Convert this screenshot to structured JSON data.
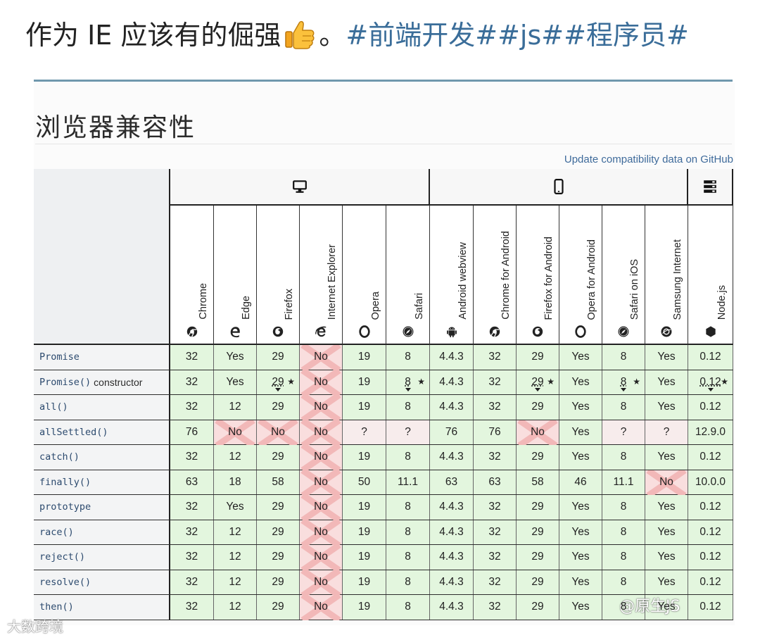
{
  "post": {
    "text": "作为 IE 应该有的倔强",
    "emoji": "thumbs-up-emoji",
    "punct": "。",
    "tags": "#前端开发##js##程序员#"
  },
  "section_title": "浏览器兼容性",
  "github_link": "Update compatibility data on GitHub",
  "groups": [
    {
      "name": "desktop",
      "icon": "desktop-icon"
    },
    {
      "name": "mobile",
      "icon": "mobile-icon"
    },
    {
      "name": "server",
      "icon": "server-icon"
    }
  ],
  "browsers": [
    {
      "name": "Chrome",
      "icon": "chrome-icon"
    },
    {
      "name": "Edge",
      "icon": "edge-icon"
    },
    {
      "name": "Firefox",
      "icon": "firefox-icon"
    },
    {
      "name": "Internet Explorer",
      "icon": "ie-icon"
    },
    {
      "name": "Opera",
      "icon": "opera-icon"
    },
    {
      "name": "Safari",
      "icon": "safari-icon"
    },
    {
      "name": "Android webview",
      "icon": "android-icon"
    },
    {
      "name": "Chrome for Android",
      "icon": "chrome-icon"
    },
    {
      "name": "Firefox for Android",
      "icon": "firefox-icon"
    },
    {
      "name": "Opera for Android",
      "icon": "opera-icon"
    },
    {
      "name": "Safari on iOS",
      "icon": "safari-icon"
    },
    {
      "name": "Samsung Internet",
      "icon": "samsung-icon"
    },
    {
      "name": "Node.js",
      "icon": "nodejs-icon"
    }
  ],
  "rows": [
    {
      "code": "Promise",
      "plain": "",
      "cells": [
        {
          "v": "32",
          "s": "yes"
        },
        {
          "v": "Yes",
          "s": "yes"
        },
        {
          "v": "29",
          "s": "yes"
        },
        {
          "v": "No",
          "s": "no"
        },
        {
          "v": "19",
          "s": "yes"
        },
        {
          "v": "8",
          "s": "yes"
        },
        {
          "v": "4.4.3",
          "s": "yes"
        },
        {
          "v": "32",
          "s": "yes"
        },
        {
          "v": "29",
          "s": "yes"
        },
        {
          "v": "Yes",
          "s": "yes"
        },
        {
          "v": "8",
          "s": "yes"
        },
        {
          "v": "Yes",
          "s": "yes"
        },
        {
          "v": "0.12",
          "s": "yes"
        }
      ]
    },
    {
      "code": "Promise()",
      "plain": "constructor",
      "cells": [
        {
          "v": "32",
          "s": "yes"
        },
        {
          "v": "Yes",
          "s": "yes"
        },
        {
          "v": "29",
          "s": "yes",
          "f": true
        },
        {
          "v": "No",
          "s": "no"
        },
        {
          "v": "19",
          "s": "yes"
        },
        {
          "v": "8",
          "s": "yes",
          "f": true
        },
        {
          "v": "4.4.3",
          "s": "yes"
        },
        {
          "v": "32",
          "s": "yes"
        },
        {
          "v": "29",
          "s": "yes",
          "f": true
        },
        {
          "v": "Yes",
          "s": "yes"
        },
        {
          "v": "8",
          "s": "yes",
          "f": true
        },
        {
          "v": "Yes",
          "s": "yes"
        },
        {
          "v": "0.12",
          "s": "yes",
          "f": true
        }
      ]
    },
    {
      "code": "all()",
      "plain": "",
      "cells": [
        {
          "v": "32",
          "s": "yes"
        },
        {
          "v": "12",
          "s": "yes"
        },
        {
          "v": "29",
          "s": "yes"
        },
        {
          "v": "No",
          "s": "no"
        },
        {
          "v": "19",
          "s": "yes"
        },
        {
          "v": "8",
          "s": "yes"
        },
        {
          "v": "4.4.3",
          "s": "yes"
        },
        {
          "v": "32",
          "s": "yes"
        },
        {
          "v": "29",
          "s": "yes"
        },
        {
          "v": "Yes",
          "s": "yes"
        },
        {
          "v": "8",
          "s": "yes"
        },
        {
          "v": "Yes",
          "s": "yes"
        },
        {
          "v": "0.12",
          "s": "yes"
        }
      ]
    },
    {
      "code": "allSettled()",
      "plain": "",
      "cells": [
        {
          "v": "76",
          "s": "yes"
        },
        {
          "v": "No",
          "s": "no"
        },
        {
          "v": "No",
          "s": "no"
        },
        {
          "v": "No",
          "s": "no"
        },
        {
          "v": "?",
          "s": "unk"
        },
        {
          "v": "?",
          "s": "unk"
        },
        {
          "v": "76",
          "s": "yes"
        },
        {
          "v": "76",
          "s": "yes"
        },
        {
          "v": "No",
          "s": "no"
        },
        {
          "v": "Yes",
          "s": "yes"
        },
        {
          "v": "?",
          "s": "unk"
        },
        {
          "v": "?",
          "s": "unk"
        },
        {
          "v": "12.9.0",
          "s": "yes"
        }
      ]
    },
    {
      "code": "catch()",
      "plain": "",
      "cells": [
        {
          "v": "32",
          "s": "yes"
        },
        {
          "v": "12",
          "s": "yes"
        },
        {
          "v": "29",
          "s": "yes"
        },
        {
          "v": "No",
          "s": "no"
        },
        {
          "v": "19",
          "s": "yes"
        },
        {
          "v": "8",
          "s": "yes"
        },
        {
          "v": "4.4.3",
          "s": "yes"
        },
        {
          "v": "32",
          "s": "yes"
        },
        {
          "v": "29",
          "s": "yes"
        },
        {
          "v": "Yes",
          "s": "yes"
        },
        {
          "v": "8",
          "s": "yes"
        },
        {
          "v": "Yes",
          "s": "yes"
        },
        {
          "v": "0.12",
          "s": "yes"
        }
      ]
    },
    {
      "code": "finally()",
      "plain": "",
      "cells": [
        {
          "v": "63",
          "s": "yes"
        },
        {
          "v": "18",
          "s": "yes"
        },
        {
          "v": "58",
          "s": "yes"
        },
        {
          "v": "No",
          "s": "no"
        },
        {
          "v": "50",
          "s": "yes"
        },
        {
          "v": "11.1",
          "s": "yes"
        },
        {
          "v": "63",
          "s": "yes"
        },
        {
          "v": "63",
          "s": "yes"
        },
        {
          "v": "58",
          "s": "yes"
        },
        {
          "v": "46",
          "s": "yes"
        },
        {
          "v": "11.1",
          "s": "yes"
        },
        {
          "v": "No",
          "s": "no"
        },
        {
          "v": "10.0.0",
          "s": "yes"
        }
      ]
    },
    {
      "code": "prototype",
      "plain": "",
      "cells": [
        {
          "v": "32",
          "s": "yes"
        },
        {
          "v": "Yes",
          "s": "yes"
        },
        {
          "v": "29",
          "s": "yes"
        },
        {
          "v": "No",
          "s": "no"
        },
        {
          "v": "19",
          "s": "yes"
        },
        {
          "v": "8",
          "s": "yes"
        },
        {
          "v": "4.4.3",
          "s": "yes"
        },
        {
          "v": "32",
          "s": "yes"
        },
        {
          "v": "29",
          "s": "yes"
        },
        {
          "v": "Yes",
          "s": "yes"
        },
        {
          "v": "8",
          "s": "yes"
        },
        {
          "v": "Yes",
          "s": "yes"
        },
        {
          "v": "0.12",
          "s": "yes"
        }
      ]
    },
    {
      "code": "race()",
      "plain": "",
      "cells": [
        {
          "v": "32",
          "s": "yes"
        },
        {
          "v": "12",
          "s": "yes"
        },
        {
          "v": "29",
          "s": "yes"
        },
        {
          "v": "No",
          "s": "no"
        },
        {
          "v": "19",
          "s": "yes"
        },
        {
          "v": "8",
          "s": "yes"
        },
        {
          "v": "4.4.3",
          "s": "yes"
        },
        {
          "v": "32",
          "s": "yes"
        },
        {
          "v": "29",
          "s": "yes"
        },
        {
          "v": "Yes",
          "s": "yes"
        },
        {
          "v": "8",
          "s": "yes"
        },
        {
          "v": "Yes",
          "s": "yes"
        },
        {
          "v": "0.12",
          "s": "yes"
        }
      ]
    },
    {
      "code": "reject()",
      "plain": "",
      "cells": [
        {
          "v": "32",
          "s": "yes"
        },
        {
          "v": "12",
          "s": "yes"
        },
        {
          "v": "29",
          "s": "yes"
        },
        {
          "v": "No",
          "s": "no"
        },
        {
          "v": "19",
          "s": "yes"
        },
        {
          "v": "8",
          "s": "yes"
        },
        {
          "v": "4.4.3",
          "s": "yes"
        },
        {
          "v": "32",
          "s": "yes"
        },
        {
          "v": "29",
          "s": "yes"
        },
        {
          "v": "Yes",
          "s": "yes"
        },
        {
          "v": "8",
          "s": "yes"
        },
        {
          "v": "Yes",
          "s": "yes"
        },
        {
          "v": "0.12",
          "s": "yes"
        }
      ]
    },
    {
      "code": "resolve()",
      "plain": "",
      "cells": [
        {
          "v": "32",
          "s": "yes"
        },
        {
          "v": "12",
          "s": "yes"
        },
        {
          "v": "29",
          "s": "yes"
        },
        {
          "v": "No",
          "s": "no"
        },
        {
          "v": "19",
          "s": "yes"
        },
        {
          "v": "8",
          "s": "yes"
        },
        {
          "v": "4.4.3",
          "s": "yes"
        },
        {
          "v": "32",
          "s": "yes"
        },
        {
          "v": "29",
          "s": "yes"
        },
        {
          "v": "Yes",
          "s": "yes"
        },
        {
          "v": "8",
          "s": "yes"
        },
        {
          "v": "Yes",
          "s": "yes"
        },
        {
          "v": "0.12",
          "s": "yes"
        }
      ]
    },
    {
      "code": "then()",
      "plain": "",
      "cells": [
        {
          "v": "32",
          "s": "yes"
        },
        {
          "v": "12",
          "s": "yes"
        },
        {
          "v": "29",
          "s": "yes"
        },
        {
          "v": "No",
          "s": "no"
        },
        {
          "v": "19",
          "s": "yes"
        },
        {
          "v": "8",
          "s": "yes"
        },
        {
          "v": "4.4.3",
          "s": "yes"
        },
        {
          "v": "32",
          "s": "yes"
        },
        {
          "v": "29",
          "s": "yes"
        },
        {
          "v": "Yes",
          "s": "yes"
        },
        {
          "v": "8",
          "s": "yes"
        },
        {
          "v": "Yes",
          "s": "yes"
        },
        {
          "v": "0.12",
          "s": "yes"
        }
      ]
    }
  ],
  "watermark_left": "大数跨境",
  "watermark_right": "@原生JS"
}
